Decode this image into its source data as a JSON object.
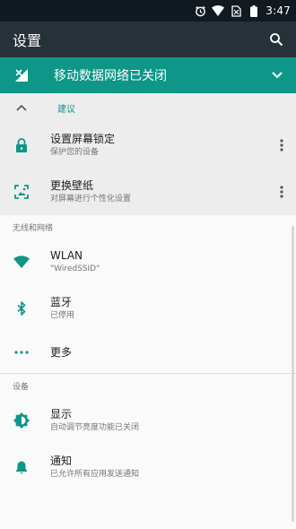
{
  "status_bar": {
    "icons": [
      "alarm-icon",
      "wifi-icon",
      "no-sim-icon",
      "battery-icon"
    ],
    "time": "3:47"
  },
  "app_bar": {
    "title": "设置",
    "search_icon": "search-icon"
  },
  "mobile_banner": {
    "icon": "signal-off-icon",
    "text": "移动数据网络已关闭",
    "chevron": "chevron-down-icon"
  },
  "suggestions": {
    "label": "建议",
    "items": [
      {
        "icon": "lock-icon",
        "title": "设置屏幕锁定",
        "subtitle": "保护您的设备"
      },
      {
        "icon": "wallpaper-icon",
        "title": "更换壁纸",
        "subtitle": "对屏幕进行个性化设置"
      }
    ]
  },
  "sections": [
    {
      "header": "无线和网络",
      "items": [
        {
          "icon": "wifi-icon",
          "title": "WLAN",
          "subtitle": "\"WiredSSID\""
        },
        {
          "icon": "bluetooth-icon",
          "title": "蓝牙",
          "subtitle": "已停用"
        },
        {
          "icon": "more-horizontal-icon",
          "title": "更多",
          "subtitle": ""
        }
      ]
    },
    {
      "header": "设备",
      "items": [
        {
          "icon": "brightness-icon",
          "title": "显示",
          "subtitle": "自动调节亮度功能已关闭"
        },
        {
          "icon": "bell-icon",
          "title": "通知",
          "subtitle": "已允许所有应用发送通知"
        }
      ]
    }
  ],
  "colors": {
    "teal": "#0e9688",
    "appbar": "#263238",
    "statusbar": "#101a20"
  }
}
